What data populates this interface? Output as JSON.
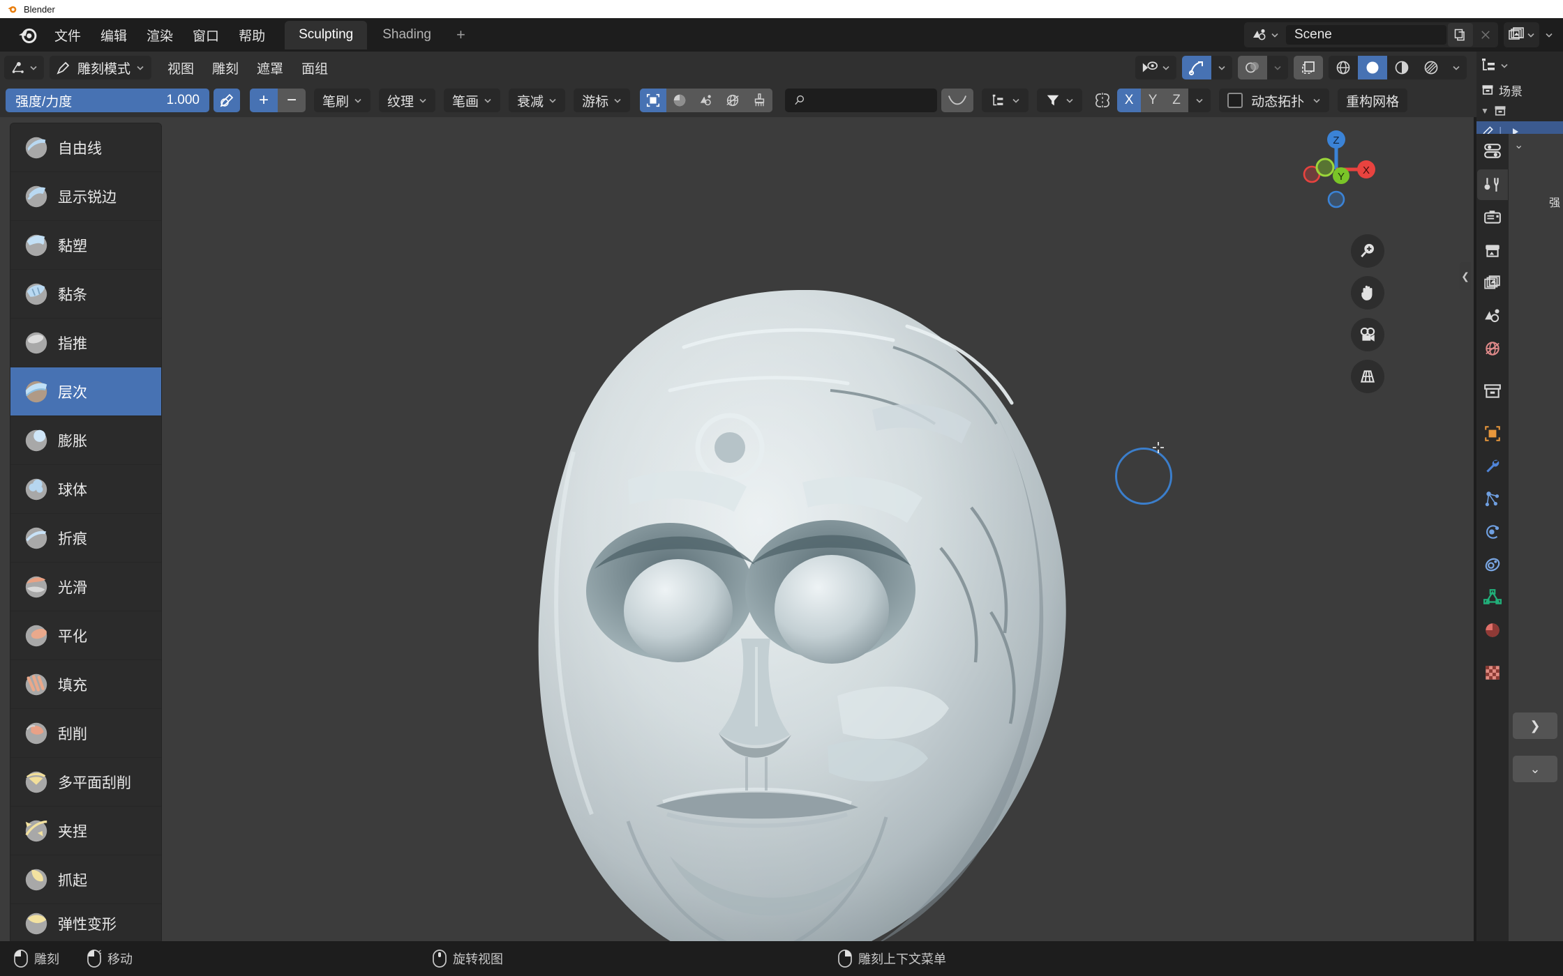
{
  "window": {
    "title": "Blender",
    "icon": "blender-logo-icon"
  },
  "topbar": {
    "menus": [
      {
        "label": "文件",
        "name": "menu-file"
      },
      {
        "label": "编辑",
        "name": "menu-edit"
      },
      {
        "label": "渲染",
        "name": "menu-render"
      },
      {
        "label": "窗口",
        "name": "menu-window"
      },
      {
        "label": "帮助",
        "name": "menu-help"
      }
    ],
    "workspaces": [
      {
        "label": "Sculpting",
        "active": true
      },
      {
        "label": "Shading",
        "active": false
      }
    ],
    "add_workspace": "+",
    "scene": {
      "name": "Scene",
      "icon": "scene-icon",
      "new_icon": "duplicate-icon",
      "unlink_icon": "x-icon"
    },
    "view_layer": {
      "icon": "view-layer-icon"
    }
  },
  "viewport_header": {
    "editor_type_icon": "editor-type-icon",
    "mode": {
      "label": "雕刻模式",
      "icon": "sculpt-mode-icon"
    },
    "menus": [
      {
        "label": "视图",
        "name": "vp-menu-view"
      },
      {
        "label": "雕刻",
        "name": "vp-menu-sculpt"
      },
      {
        "label": "遮罩",
        "name": "vp-menu-mask"
      },
      {
        "label": "面组",
        "name": "vp-menu-facesets"
      }
    ],
    "right_controls": {
      "visibility_icon": "visibility-icon",
      "gizmo_icon": "gizmo-icon",
      "gizmo_active": true,
      "overlay_icon": "overlays-icon",
      "xray_icon": "xray-icon",
      "shading": [
        {
          "icon": "wireframe-icon",
          "active": false
        },
        {
          "icon": "solid-icon",
          "active": true
        },
        {
          "icon": "material-preview-icon",
          "active": false
        },
        {
          "icon": "rendered-icon",
          "active": false
        }
      ]
    }
  },
  "tool_settings": {
    "strength": {
      "label": "强度/力度",
      "value": "1.000",
      "accent": "#4772b3"
    },
    "pressure_icon": "pressure-icon",
    "add_label": "+",
    "subtract_label": "−",
    "dropdowns": [
      {
        "label": "笔刷",
        "name": "dropdown-brush"
      },
      {
        "label": "纹理",
        "name": "dropdown-texture"
      },
      {
        "label": "笔画",
        "name": "dropdown-stroke"
      },
      {
        "label": "衰减",
        "name": "dropdown-falloff"
      },
      {
        "label": "游标",
        "name": "dropdown-cursor"
      }
    ],
    "segment_icons": [
      {
        "icon": "mask-icon",
        "active": true
      },
      {
        "icon": "shading-ball-icon",
        "active": false
      },
      {
        "icon": "scene-drop-icon",
        "active": false
      },
      {
        "icon": "world-icon",
        "active": false
      },
      {
        "icon": "brush-flat-icon",
        "active": false
      }
    ],
    "search": {
      "placeholder": "",
      "value": "",
      "icon": "search-icon"
    },
    "curve_icon": "falloff-curve-icon",
    "options_icon": "options-icon",
    "filter_icon": "filter-icon",
    "symmetry_icon": "symmetry-icon",
    "symmetry_axes": [
      {
        "label": "X",
        "active": true
      },
      {
        "label": "Y",
        "active": false
      },
      {
        "label": "Z",
        "active": false
      }
    ],
    "dyntopo": {
      "label": "动态拓扑",
      "checked": false
    },
    "remesh": {
      "label": "重构网格"
    }
  },
  "brush_list": [
    {
      "label": "自由线",
      "selected": false,
      "color": "#b9d9f2"
    },
    {
      "label": "显示锐边",
      "selected": false,
      "color": "#b9d9f2"
    },
    {
      "label": "黏塑",
      "selected": false,
      "color": "#c3e0f5"
    },
    {
      "label": "黏条",
      "selected": false,
      "color": "#b9d9f2"
    },
    {
      "label": "指推",
      "selected": false,
      "color": "#d8d8d8"
    },
    {
      "label": "层次",
      "selected": true,
      "color": "#bfe0f7"
    },
    {
      "label": "膨胀",
      "selected": false,
      "color": "#cfe6f8"
    },
    {
      "label": "球体",
      "selected": false,
      "color": "#b6d6f0"
    },
    {
      "label": "折痕",
      "selected": false,
      "color": "#c8e2f7"
    },
    {
      "label": "光滑",
      "selected": false,
      "color": "#e8a183"
    },
    {
      "label": "平化",
      "selected": false,
      "color": "#eaa98c"
    },
    {
      "label": "填充",
      "selected": false,
      "color": "#eaa88a"
    },
    {
      "label": "刮削",
      "selected": false,
      "color": "#e9a187"
    },
    {
      "label": "多平面刮削",
      "selected": false,
      "color": "#f2df9a"
    },
    {
      "label": "夹捏",
      "selected": false,
      "color": "#f3e2a0"
    },
    {
      "label": "抓起",
      "selected": false,
      "color": "#f3e2a0"
    },
    {
      "label": "弹性变形",
      "selected": false,
      "color": "#f3e2a0"
    }
  ],
  "gizmo": {
    "axes": [
      {
        "label": "Z",
        "color": "#3b83d6"
      },
      {
        "label": "Y",
        "color": "#7ac528"
      },
      {
        "label": "X",
        "color": "#e8433f"
      }
    ]
  },
  "viewport_tools": [
    {
      "icon": "zoom-icon",
      "name": "zoom-tool"
    },
    {
      "icon": "hand-icon",
      "name": "pan-tool"
    },
    {
      "icon": "camera-icon",
      "name": "camera-view-tool"
    },
    {
      "icon": "grid-icon",
      "name": "ortho-toggle-tool"
    }
  ],
  "outliner": {
    "editor_icon": "outliner-icon",
    "scene_label": "场景",
    "collection_icon": "collection-icon",
    "disclosure": "▼",
    "object_icon": "sculpt-object-icon",
    "play_icon": "triangle-right-icon"
  },
  "properties": {
    "editor_icon": "properties-icon",
    "tabs": [
      {
        "icon": "tool-icon",
        "color": "#d8d8d8",
        "active": true
      },
      {
        "icon": "render-icon",
        "color": "#d8d8d8",
        "active": false
      },
      {
        "icon": "output-icon",
        "color": "#d8d8d8",
        "active": false
      },
      {
        "icon": "view-layer-icon",
        "color": "#d8d8d8",
        "active": false
      },
      {
        "icon": "scene-icon",
        "color": "#d8d8d8",
        "active": false
      },
      {
        "icon": "world-icon",
        "color": "#e08a8a",
        "active": false
      },
      {
        "icon": "collection-icon",
        "color": "#d8d8d8",
        "active": false
      },
      {
        "icon": "object-icon",
        "color": "#e8973c",
        "active": false
      },
      {
        "icon": "modifier-icon",
        "color": "#4f84d8",
        "active": false
      },
      {
        "icon": "particles-icon",
        "color": "#6f9fe0",
        "active": false
      },
      {
        "icon": "physics-icon",
        "color": "#6f9fe0",
        "active": false
      },
      {
        "icon": "constraints-icon",
        "color": "#7aa7e4",
        "active": false
      },
      {
        "icon": "object-data-icon",
        "color": "#21b07a",
        "active": false
      },
      {
        "icon": "material-icon",
        "color": "#e0706a",
        "active": false
      },
      {
        "icon": "texture-icon",
        "color": "#e08a80",
        "active": false
      }
    ],
    "breadcrumb_chev": "⌄",
    "side_label": "强",
    "expand_label": "❯"
  },
  "statusbar": [
    {
      "label": "雕刻",
      "icon": "mouse-left-icon"
    },
    {
      "label": "移动",
      "icon": "mouse-left-drag-icon"
    },
    {
      "label": "旋转视图",
      "icon": "mouse-middle-icon"
    },
    {
      "label": "雕刻上下文菜单",
      "icon": "mouse-right-icon"
    }
  ]
}
